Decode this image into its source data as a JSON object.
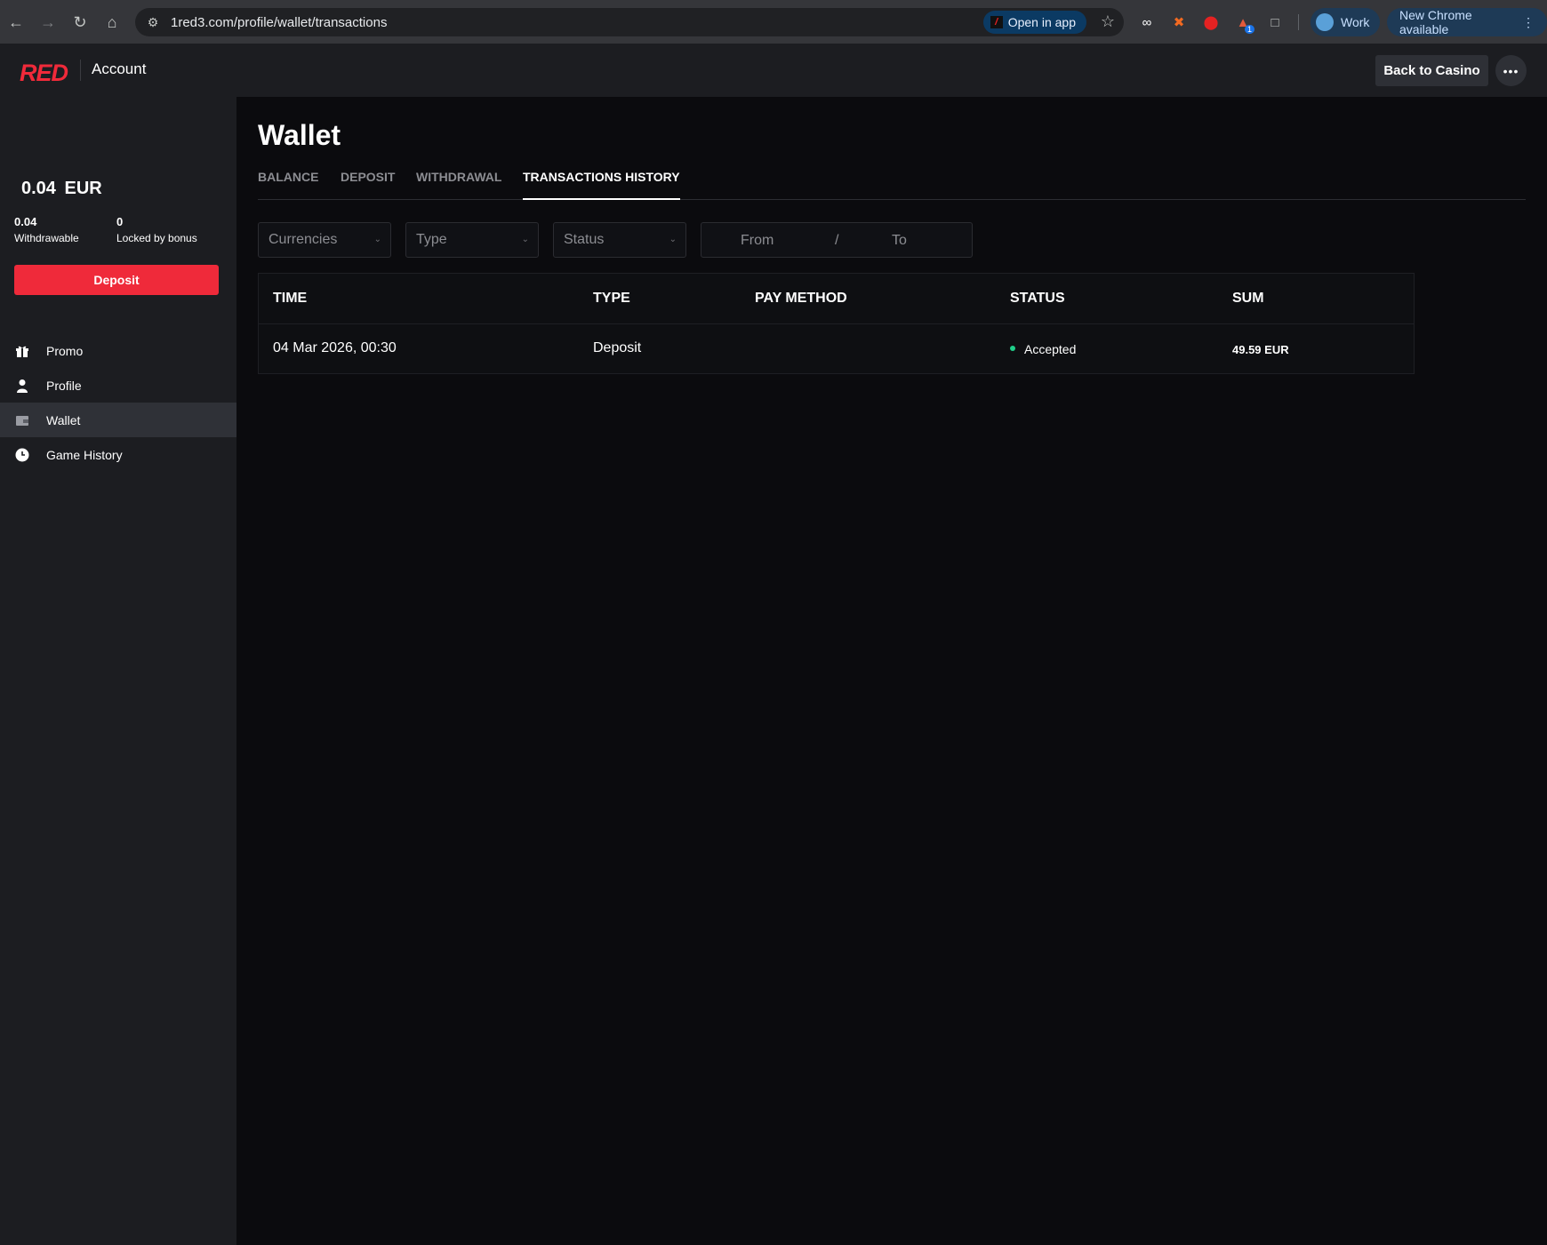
{
  "browser": {
    "url": "1red3.com/profile/wallet/transactions",
    "open_in_app": "Open in app",
    "profile_label": "Work",
    "update_label": "New Chrome available",
    "extension_badge": "1"
  },
  "header": {
    "logo": "RED",
    "title": "Account",
    "back_button": "Back to Casino",
    "more_button": "•••"
  },
  "sidebar": {
    "balance": "0.04 EUR",
    "withdrawable_value": "0.04",
    "withdrawable_label": "Withdrawable",
    "locked_value": "0",
    "locked_label": "Locked by bonus",
    "deposit_button": "Deposit",
    "items": [
      {
        "label": "Promo",
        "icon": "gift-icon"
      },
      {
        "label": "Profile",
        "icon": "user-icon"
      },
      {
        "label": "Wallet",
        "icon": "wallet-icon",
        "active": true
      },
      {
        "label": "Game History",
        "icon": "clock-icon"
      }
    ]
  },
  "main": {
    "title": "Wallet",
    "tabs": [
      {
        "label": "BALANCE"
      },
      {
        "label": "DEPOSIT"
      },
      {
        "label": "WITHDRAWAL"
      },
      {
        "label": "TRANSACTIONS HISTORY",
        "active": true
      }
    ],
    "filters": {
      "currencies": "Currencies",
      "type": "Type",
      "status": "Status",
      "from": "From",
      "separator": "/",
      "to": "To"
    },
    "table": {
      "headers": [
        "TIME",
        "TYPE",
        "PAY METHOD",
        "STATUS",
        "SUM"
      ],
      "rows": [
        {
          "time": "04 Mar 2026, 00:30",
          "type": "Deposit",
          "pay_method": "",
          "status": "Accepted",
          "sum": "49.59 EUR"
        }
      ]
    }
  },
  "colors": {
    "brand_red": "#ef2a3a",
    "status_accepted": "#1fcf8a"
  }
}
